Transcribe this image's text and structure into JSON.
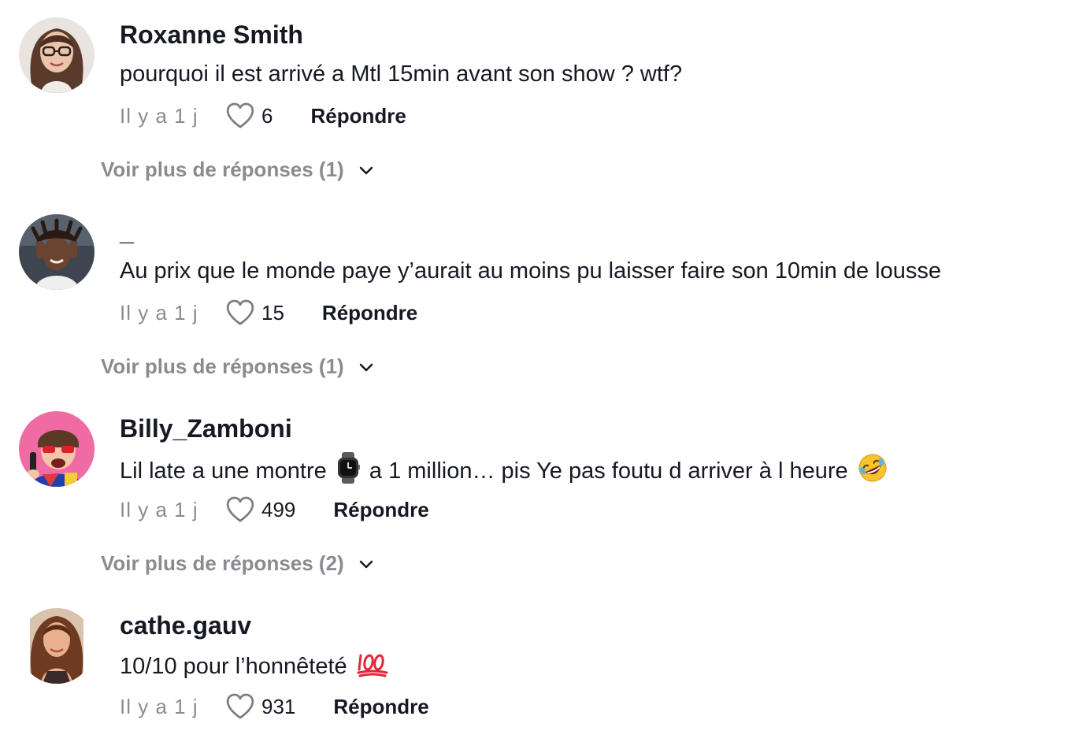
{
  "comments": [
    {
      "username": "Roxanne Smith",
      "text": "pourquoi il est arrivé a Mtl 15min avant son show ? wtf?",
      "time": "Il y a 1 j",
      "likes": "6",
      "reply": "Répondre",
      "more_replies": "Voir plus de réponses (1)",
      "avatar_icon": "avatar-photo"
    },
    {
      "username": "_",
      "text": "Au prix que le monde paye y’aurait au moins pu laisser faire son 10min de lousse",
      "time": "Il y a 1 j",
      "likes": "15",
      "reply": "Répondre",
      "more_replies": "Voir plus de réponses (1)",
      "avatar_icon": "avatar-photo"
    },
    {
      "username": "Billy_Zamboni",
      "text_before_watch": "Lil late a une montre",
      "text_after_watch": "a 1 million… pis Ye pas foutu d arriver à l heure",
      "emoji_1": "watch-emoji",
      "emoji_2": "rolling-on-floor-laughing-emoji",
      "time": "Il y a 1 j",
      "likes": "499",
      "reply": "Répondre",
      "more_replies": "Voir plus de réponses (2)",
      "avatar_icon": "avatar-photo"
    },
    {
      "username": "cathe.gauv",
      "text": "10/10 pour l’honnêteté",
      "emoji": "hundred-points-emoji",
      "time": "Il y a 1 j",
      "likes": "931",
      "reply": "Répondre",
      "avatar_icon": "avatar-photo"
    }
  ],
  "icons": {
    "like": "heart-outline-icon",
    "expand": "chevron-down-icon"
  },
  "colors": {
    "text": "#161823",
    "muted": "rgba(22,24,35,0.5)"
  }
}
